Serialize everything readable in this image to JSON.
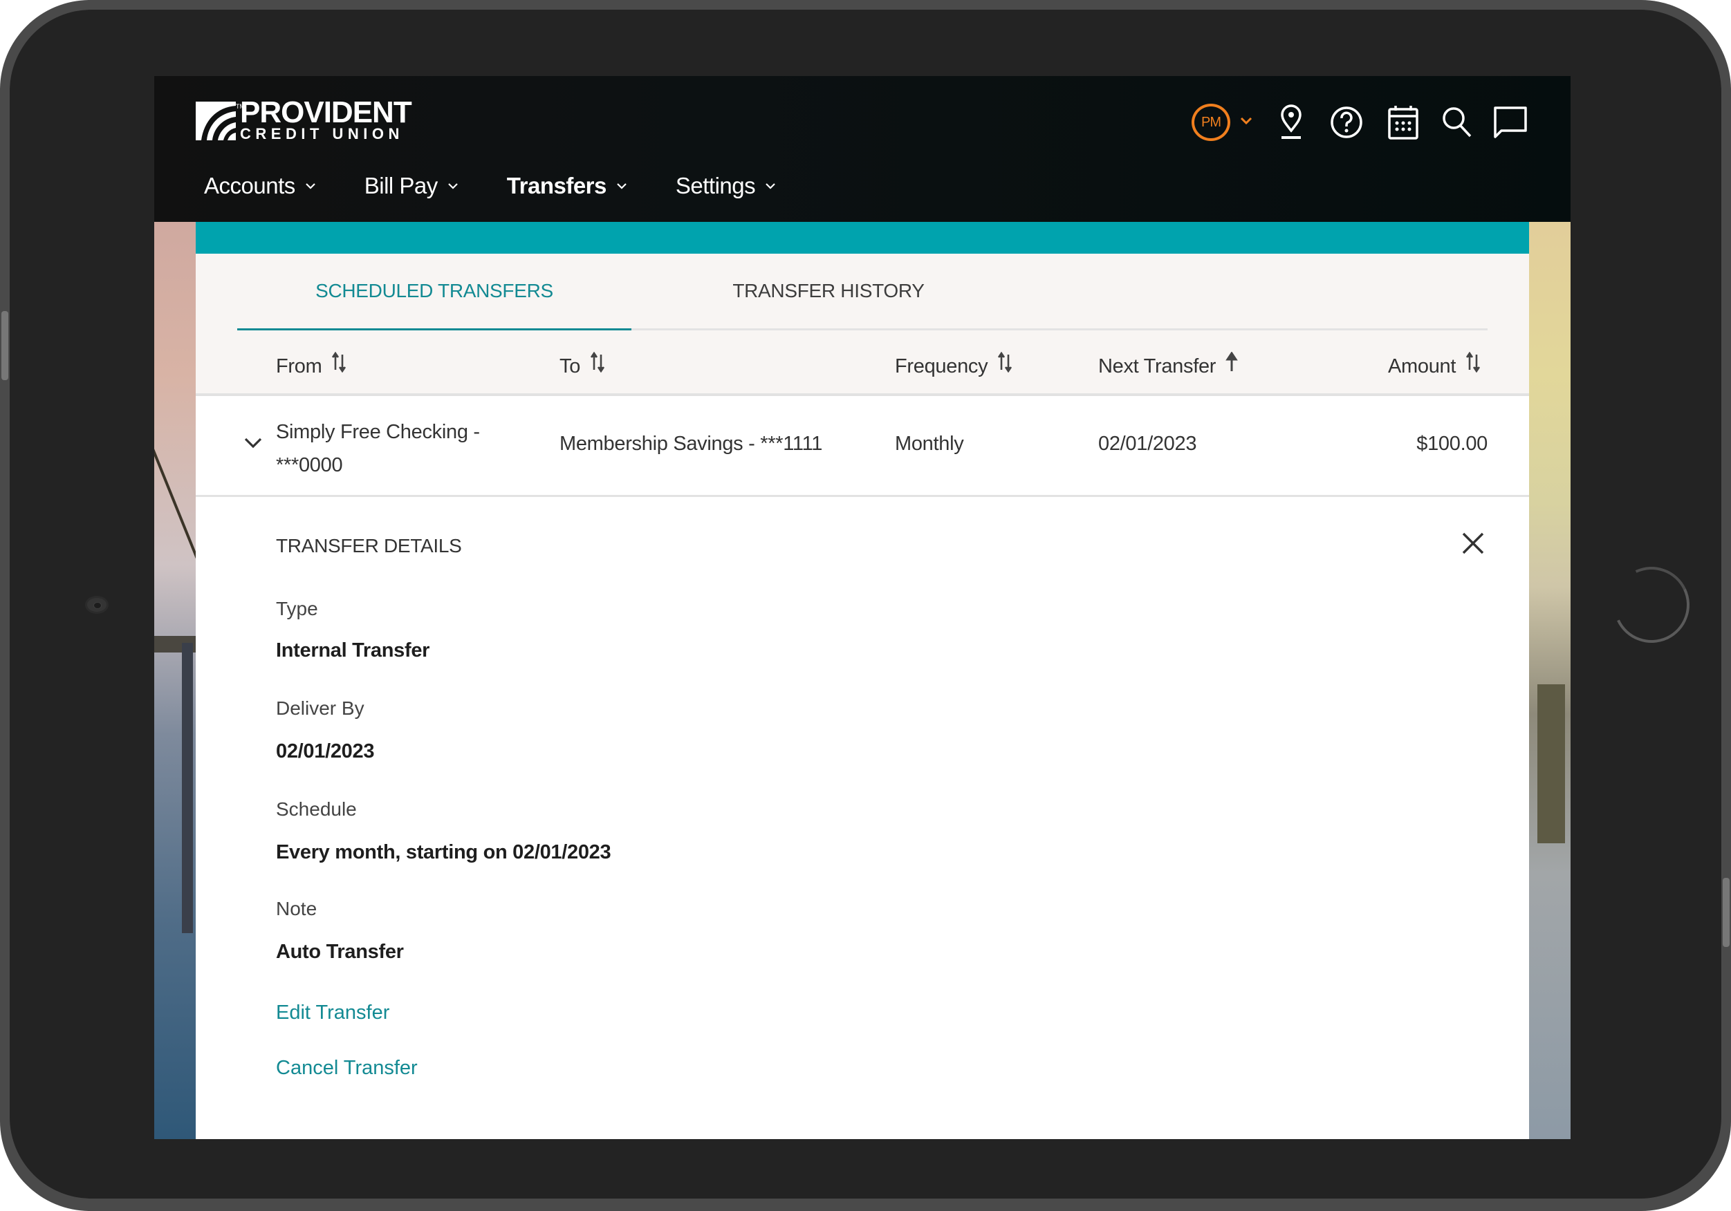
{
  "brand": {
    "name_line1": "PROVIDENT",
    "name_line2": "CREDIT UNION",
    "trademark": "TM"
  },
  "header": {
    "user_initials": "PM",
    "icons": [
      "user-menu-caret",
      "location-pin",
      "help",
      "calendar",
      "search",
      "chat"
    ]
  },
  "nav": {
    "items": [
      {
        "label": "Accounts",
        "active": false
      },
      {
        "label": "Bill Pay",
        "active": false
      },
      {
        "label": "Transfers",
        "active": true
      },
      {
        "label": "Settings",
        "active": false
      }
    ]
  },
  "tabs": [
    {
      "label": "SCHEDULED TRANSFERS",
      "active": true
    },
    {
      "label": "TRANSFER HISTORY",
      "active": false
    }
  ],
  "table": {
    "columns": [
      {
        "label": "From",
        "sort": "both"
      },
      {
        "label": "To",
        "sort": "both"
      },
      {
        "label": "Frequency",
        "sort": "both"
      },
      {
        "label": "Next Transfer",
        "sort": "ascending"
      },
      {
        "label": "Amount",
        "sort": "both"
      }
    ],
    "rows": [
      {
        "from_line1": "Simply Free Checking -",
        "from_line2": "***0000",
        "to": "Membership Savings - ***1111",
        "frequency": "Monthly",
        "next_transfer": "02/01/2023",
        "amount": "$100.00",
        "expanded": true
      }
    ]
  },
  "details": {
    "title": "TRANSFER DETAILS",
    "fields": [
      {
        "label": "Type",
        "value": "Internal Transfer"
      },
      {
        "label": "Deliver By",
        "value": "02/01/2023"
      },
      {
        "label": "Schedule",
        "value": "Every month, starting on 02/01/2023"
      },
      {
        "label": "Note",
        "value": "Auto Transfer"
      }
    ],
    "actions": {
      "edit": "Edit Transfer",
      "cancel": "Cancel Transfer"
    }
  },
  "colors": {
    "accent_teal": "#00a3ae",
    "link_teal": "#138a93",
    "avatar_orange": "#f07f1e",
    "header_bg": "#0c1112"
  }
}
